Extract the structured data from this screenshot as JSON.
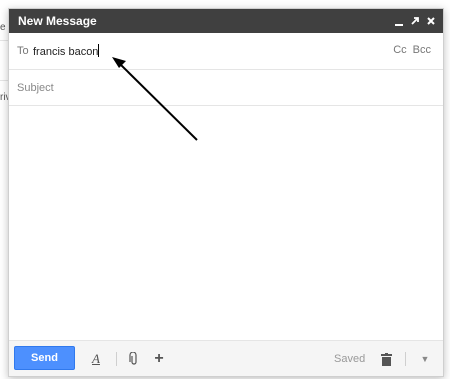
{
  "compose": {
    "title": "New Message",
    "title_icons": {
      "minimize": "minimize-icon",
      "popout": "popout-icon",
      "close": "close-icon"
    },
    "to_label": "To",
    "to_value": "francis bacon",
    "cc_label": "Cc",
    "bcc_label": "Bcc",
    "subject_placeholder": "Subject",
    "body_text": ""
  },
  "toolbar": {
    "send_label": "Send",
    "saved_label": "Saved",
    "icons": [
      "formatting-icon",
      "attach-icon",
      "more-options-plus-icon",
      "trash-icon",
      "chevron-down-icon"
    ]
  },
  "background": {
    "text_fragments": [
      "e",
      "riv"
    ]
  },
  "colors": {
    "titlebar": "#404040",
    "send_button": "#4d90fe",
    "arrow": "#000000"
  }
}
